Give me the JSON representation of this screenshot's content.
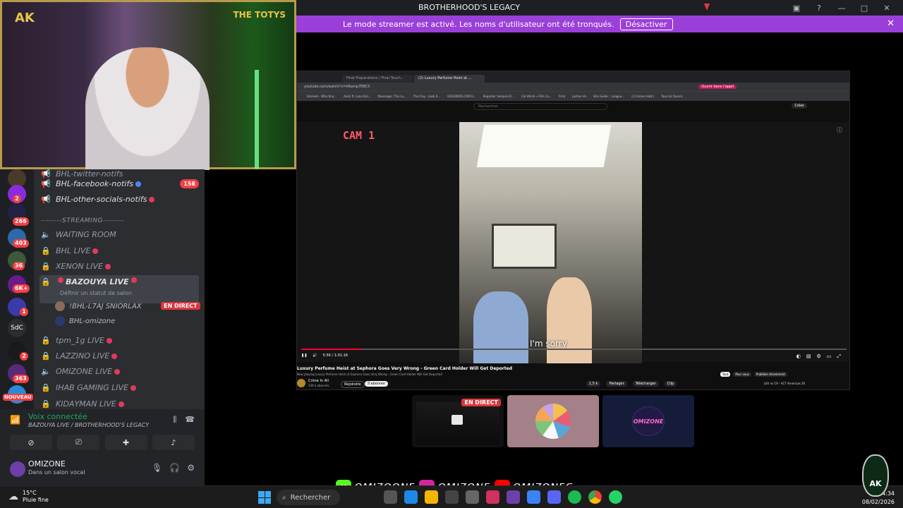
{
  "window": {
    "title": "BROTHERHOOD'S LEGACY"
  },
  "banner": {
    "message": "Le mode streamer est activé. Les noms d'utilisateur ont été tronqués.",
    "button": "Désactiver"
  },
  "webcam": {
    "logo_left": "AK",
    "logo_right": "THE TOTYS"
  },
  "servers": {
    "badges": [
      "2",
      "266",
      "403",
      "36",
      "6K+",
      "1",
      "2",
      "363"
    ],
    "text_server": "SdC",
    "new_label": "NOUVEAU"
  },
  "channels": {
    "top_partial": "BHL-twitter-notifs",
    "facebook": {
      "name": "BHL-facebook-notifs",
      "badge": "158"
    },
    "other_socials": {
      "name": "BHL-other-socials-notifs"
    },
    "category": "--------STREAMING--------",
    "waiting_room": "WAITING ROOM",
    "voice": [
      {
        "name": "BHL LIVE"
      },
      {
        "name": "XENON LIVE"
      },
      {
        "name": "BAZOUYA LIVE",
        "status": "Définir un statut de salon"
      },
      {
        "name": "tpm_1g LIVE"
      },
      {
        "name": "LAZZINO LIVE"
      },
      {
        "name": "OMIZONE LIVE"
      },
      {
        "name": "IHAB GAMING LIVE"
      },
      {
        "name": "KIDAYMAN LIVE"
      }
    ],
    "voice_users": [
      {
        "name": "!BHL-L7AJ SNIORLAX",
        "tag": "EN DIRECT"
      },
      {
        "name": "BHL-omizone"
      }
    ]
  },
  "voice_panel": {
    "title": "Voix connectée",
    "subtitle": "BAZOUYA LIVE / BROTHERHOOD'S LEGACY"
  },
  "user_panel": {
    "name": "OMIZONE",
    "status": "Dans un salon vocal"
  },
  "browser": {
    "tabs": [
      "Final Preparations | Final Touch...",
      "(2) Luxury Perfume Heist at ..."
    ],
    "url": "youtube.com/watch?v=hRamp7EBC5",
    "open_app": "Ouvrir dans l'appli",
    "bookmarks": [
      "Eminem - Who Kno...",
      "Avicii ft. Lana Del...",
      "Passenger: The La...",
      "The Fray - Look A...",
      "GOGOKIDS.COM H...",
      "Regarder Vampire D...",
      "Cet été-là » Film Co...",
      "Fshd",
      "Justine Vo",
      "Site Guide :: League...",
      "(1) Imane Hab's",
      "Tous les favoris"
    ],
    "search_placeholder": "Rechercher",
    "create": "Créer"
  },
  "video": {
    "cam_label": "CAM 1",
    "subtitle": "I'm sorry",
    "time": "5:56 / 1:01:16",
    "progress": 0.11,
    "title": "Luxury Perfume Heist at Sephora Goes Very Wrong - Green Card Holder Will Get Deported",
    "description": "Now playing Luxury Perfume Heist at Sephora Goes Very Wrong - Green Card Holder Will Get Deported",
    "channel": "Crime In All",
    "subscribers": "339 k abonnés",
    "join": "Rejoindre",
    "subscribe": "S'abonner",
    "likes": "1,5 k",
    "share": "Partager",
    "download": "Télécharger",
    "clip": "Clip",
    "chips": [
      "Tout",
      "Pour vous",
      "Publiées récemment"
    ],
    "side_video": "LEV vs C9 - VCT Americas 26"
  },
  "tiles": {
    "live_tag": "EN DIRECT",
    "omizone_logo": "OMIZONE"
  },
  "socials": [
    {
      "icon": "K",
      "name": "OMIZOONE",
      "color": "#53fc18"
    },
    {
      "icon": "◎",
      "name": "OMIZONE",
      "color": "#d6249f"
    },
    {
      "icon": "▶",
      "name": "OMIZONEG",
      "color": "#ff0000"
    }
  ],
  "taskbar": {
    "temp": "15°C",
    "weather": "Pluie fine",
    "search": "Rechercher",
    "time": "14:34",
    "date": "08/02/2026"
  },
  "badge": {
    "text": "AK"
  }
}
